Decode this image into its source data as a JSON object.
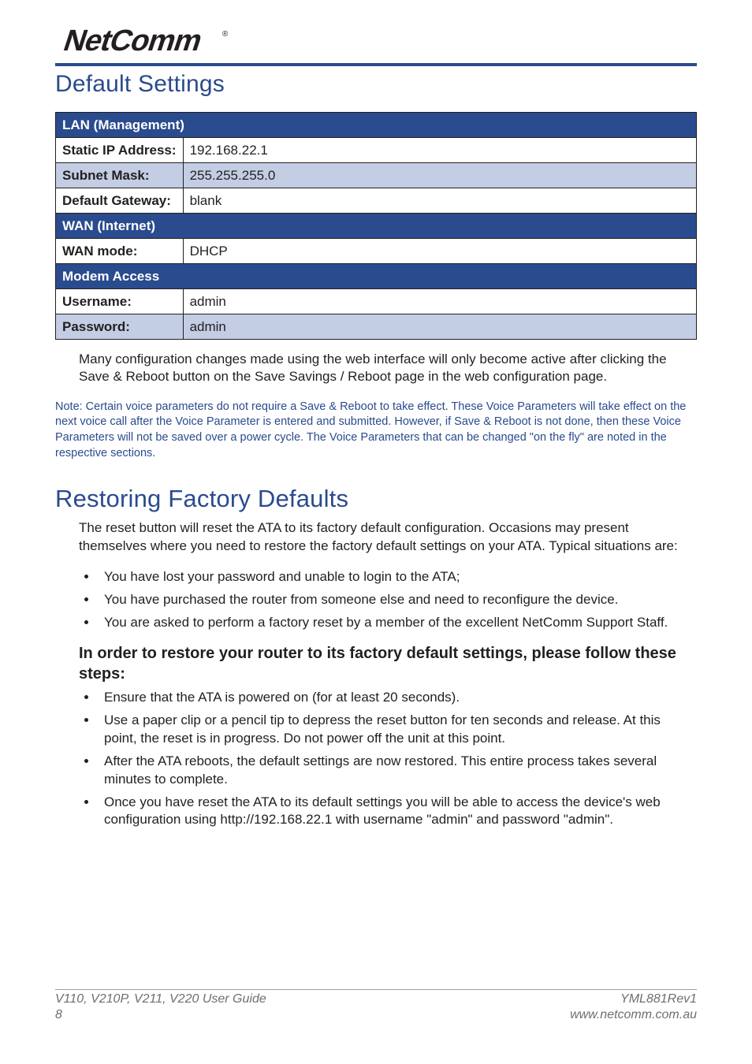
{
  "brand": {
    "name": "NetComm"
  },
  "heading1": "Default Settings",
  "table": {
    "groups": [
      {
        "title": "LAN (Management)",
        "rows": [
          {
            "label": "Static IP Address:",
            "value": "192.168.22.1",
            "alt": false
          },
          {
            "label": "Subnet Mask:",
            "value": "255.255.255.0",
            "alt": true
          },
          {
            "label": "Default Gateway:",
            "value": "blank",
            "alt": false
          }
        ]
      },
      {
        "title": "WAN (Internet)",
        "rows": [
          {
            "label": "WAN mode:",
            "value": "DHCP",
            "alt": false
          }
        ]
      },
      {
        "title": "Modem Access",
        "rows": [
          {
            "label": "Username:",
            "value": "admin",
            "alt": false
          },
          {
            "label": "Password:",
            "value": "admin",
            "alt": true
          }
        ]
      }
    ]
  },
  "para1": "Many configuration changes made using the web interface will only become active after clicking the Save & Reboot button on the Save Savings / Reboot page in the web configuration page.",
  "note": "Note: Certain voice parameters do not require a Save & Reboot to take effect. These Voice Parameters will take effect on the next voice call after the Voice Parameter is entered and submitted. However, if Save & Reboot is not done, then these Voice Parameters will not be saved over a power cycle. The Voice Parameters that can be changed \"on the fly\" are noted in the respective sections.",
  "heading2": "Restoring Factory Defaults",
  "para2": "The reset button will reset the ATA to its factory default configuration. Occasions may present themselves where you need to restore the factory default settings on your ATA. Typical situations are:",
  "situations": [
    "You have lost your password and unable to login to the ATA;",
    "You have purchased the router from someone else and need to reconfigure the device.",
    "You are asked to perform a factory reset by a member of the excellent NetComm Support Staff."
  ],
  "subhead": "In order to restore your router to its factory default settings, please follow these steps:",
  "steps": [
    "Ensure that the ATA is powered on (for at least 20 seconds).",
    "Use a paper clip or a pencil tip to depress the reset button for ten seconds and release. At this point, the reset is in progress. Do not power off the unit at this point.",
    "After the ATA reboots, the default settings are now restored. This entire process takes several minutes to complete.",
    "Once you have reset the ATA to its default settings you will be able to access the device's web configuration using http://192.168.22.1 with username \"admin\" and password \"admin\"."
  ],
  "footer": {
    "left": "V110, V210P, V211, V220 User Guide",
    "right": "YML881Rev1",
    "page": "8",
    "url": "www.netcomm.com.au"
  }
}
